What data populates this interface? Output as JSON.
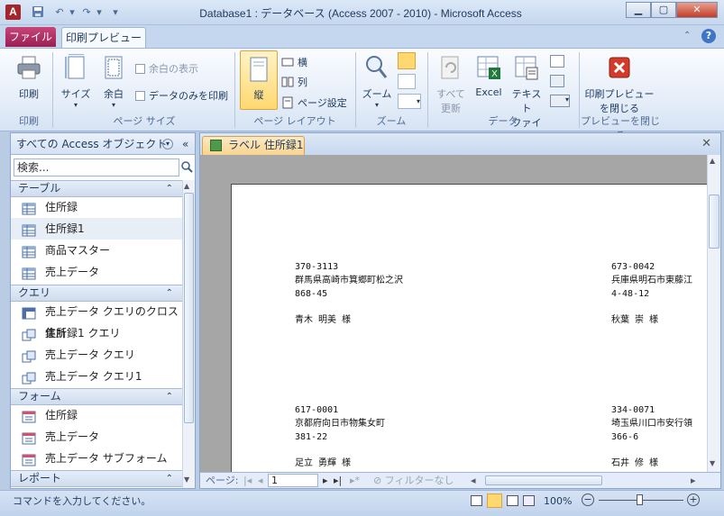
{
  "window": {
    "title": "Database1 : データベース (Access 2007 - 2010) - Microsoft Access",
    "app_icon_letter": "A"
  },
  "tabs": {
    "file": "ファイル",
    "print_preview": "印刷プレビュー"
  },
  "ribbon": {
    "print": "印刷",
    "size": "サイズ",
    "margins": "余白",
    "show_margins": "余白の表示",
    "print_data_only": "データのみを印刷",
    "portrait": "縦",
    "landscape": "横",
    "columns": "列",
    "page_setup": "ページ設定",
    "zoom": "ズーム",
    "refresh_all_line1": "すべて",
    "refresh_all_line2": "更新",
    "excel": "Excel",
    "text_file_line1": "テキスト",
    "text_file_line2": "ファイル",
    "close_preview_line1": "印刷プレビュー",
    "close_preview_line2": "を閉じる",
    "groups": {
      "print": "印刷",
      "page_size": "ページ サイズ",
      "page_layout": "ページ レイアウト",
      "zoom": "ズーム",
      "data": "データ",
      "close_preview": "プレビューを閉じる"
    }
  },
  "nav": {
    "header": "すべての Access オブジェクト",
    "search_placeholder": "検索...",
    "sections": [
      {
        "label": "テーブル",
        "items": [
          "住所録",
          "住所録1",
          "商品マスター",
          "売上データ"
        ]
      },
      {
        "label": "クエリ",
        "items": [
          "売上データ クエリのクロス集計",
          "住所録1 クエリ",
          "売上データ クエリ",
          "売上データ クエリ1"
        ]
      },
      {
        "label": "フォーム",
        "items": [
          "住所録",
          "売上データ",
          "売上データ サブフォーム"
        ]
      },
      {
        "label": "レポート",
        "items": []
      }
    ]
  },
  "document": {
    "tab_label": "ラベル 住所録1",
    "labels": [
      {
        "zip": "370-3113",
        "address": "群馬県高崎市箕郷町松之沢",
        "number": "868-45",
        "name": "青木 明美  様"
      },
      {
        "zip": "673-0042",
        "address": "兵庫県明石市東藤江",
        "number": "4-48-12",
        "name": "秋葉 崇  様"
      },
      {
        "zip": "617-0001",
        "address": "京都府向日市物集女町",
        "number": "381-22",
        "name": "足立 勇輝  様"
      },
      {
        "zip": "334-0071",
        "address": "埼玉県川口市安行領",
        "number": "366-6",
        "name": "石井 修  様"
      }
    ]
  },
  "record_nav": {
    "page_label": "ページ:",
    "page_value": "1",
    "filter": "フィルターなし"
  },
  "status": {
    "text": "コマンドを入力してください。",
    "zoom": "100%"
  },
  "colors": {
    "file_tab": "#9a1f52",
    "accent_tab": "#f9d48f",
    "ribbon_bg": "#e3ecf8"
  }
}
